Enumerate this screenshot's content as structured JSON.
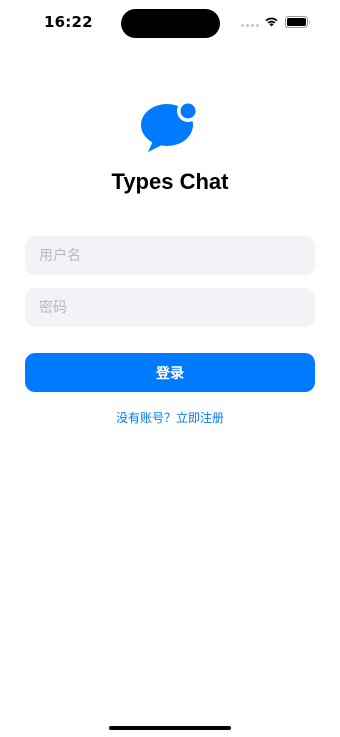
{
  "status_bar": {
    "time": "16:22",
    "wifi_icon": "wifi-icon",
    "battery_icon": "battery-icon"
  },
  "app": {
    "title": "Types Chat",
    "logo_icon": "chat-bubble-icon",
    "accent_color": "#007aff"
  },
  "form": {
    "username": {
      "value": "",
      "placeholder": "用户名"
    },
    "password": {
      "value": "",
      "placeholder": "密码"
    },
    "login_label": "登录",
    "register_link": "没有账号？立即注册"
  }
}
